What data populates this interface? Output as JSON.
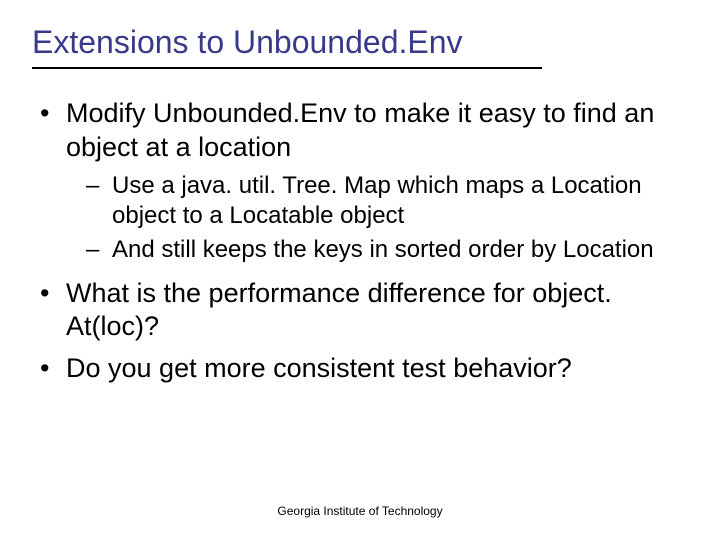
{
  "title": "Extensions to Unbounded.Env",
  "bullets": [
    {
      "text": "Modify Unbounded.Env to make it easy to find an object at a location",
      "sub": [
        "Use a java. util. Tree. Map which maps a Location object to a Locatable object",
        "And still keeps the keys in sorted order by Location"
      ]
    },
    {
      "text": "What is the performance difference for object. At(loc)?",
      "sub": []
    },
    {
      "text": "Do you get more consistent test behavior?",
      "sub": []
    }
  ],
  "footer": "Georgia Institute of Technology"
}
